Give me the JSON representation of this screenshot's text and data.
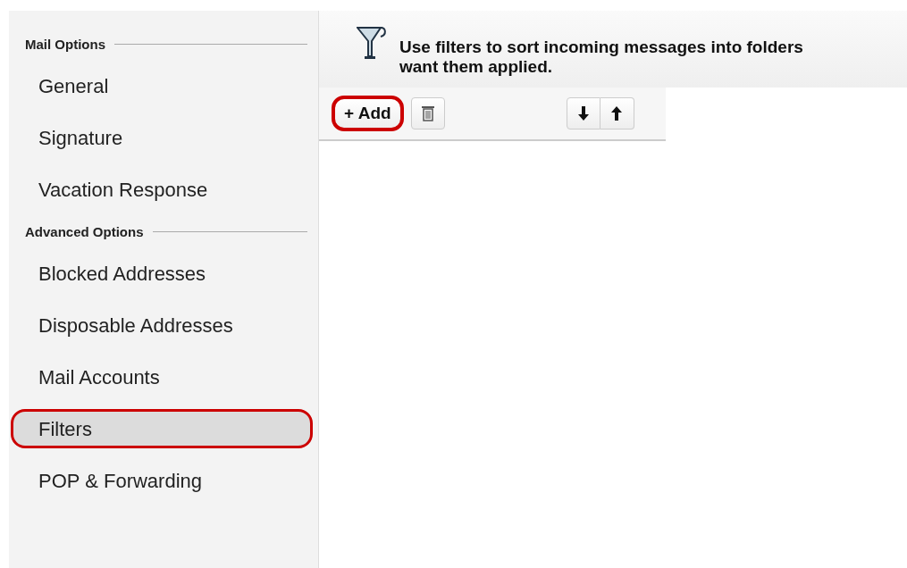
{
  "sidebar": {
    "sections": [
      {
        "title": "Mail Options",
        "items": [
          {
            "label": "General",
            "selected": false,
            "highlighted": false
          },
          {
            "label": "Signature",
            "selected": false,
            "highlighted": false
          },
          {
            "label": "Vacation Response",
            "selected": false,
            "highlighted": false
          }
        ]
      },
      {
        "title": "Advanced Options",
        "items": [
          {
            "label": "Blocked Addresses",
            "selected": false,
            "highlighted": false
          },
          {
            "label": "Disposable Addresses",
            "selected": false,
            "highlighted": false
          },
          {
            "label": "Mail Accounts",
            "selected": false,
            "highlighted": false
          },
          {
            "label": "Filters",
            "selected": true,
            "highlighted": true
          },
          {
            "label": "POP & Forwarding",
            "selected": false,
            "highlighted": false
          }
        ]
      }
    ]
  },
  "header": {
    "lines": [
      "Use filters to sort incoming messages into folders",
      "want them applied."
    ]
  },
  "toolbar": {
    "buttons": [
      {
        "kind": "add",
        "label": "+ Add",
        "highlighted": true
      },
      {
        "kind": "delete",
        "highlighted": false
      },
      {
        "kind": "down",
        "highlighted": false
      },
      {
        "kind": "up",
        "highlighted": false
      }
    ]
  }
}
